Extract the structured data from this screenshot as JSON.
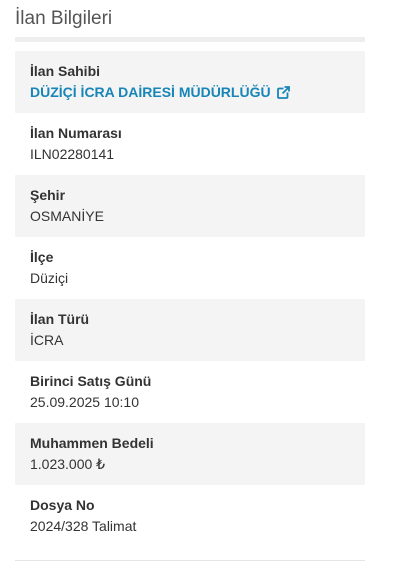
{
  "panel": {
    "title": "İlan Bilgileri"
  },
  "fields": {
    "owner": {
      "label": "İlan Sahibi",
      "value": "DÜZİÇİ İCRA DAİRESİ MÜDÜRLÜĞÜ",
      "icon": "external-link-icon",
      "link_color": "#1785b8"
    },
    "listing_number": {
      "label": "İlan Numarası",
      "value": "ILN02280141"
    },
    "city": {
      "label": "Şehir",
      "value": "OSMANİYE"
    },
    "district": {
      "label": "İlçe",
      "value": "Düziçi"
    },
    "listing_type": {
      "label": "İlan Türü",
      "value": "İCRA"
    },
    "first_sale_day": {
      "label": "Birinci Satış Günü",
      "value": "25.09.2025 10:10"
    },
    "estimated_value": {
      "label": "Muhammen Bedeli",
      "value": "1.023.000 ₺"
    },
    "file_number": {
      "label": "Dosya No",
      "value": "2024/328 Talimat"
    }
  },
  "colors": {
    "shaded_row": "#f4f4f4",
    "text": "#333333",
    "title": "#555555"
  }
}
